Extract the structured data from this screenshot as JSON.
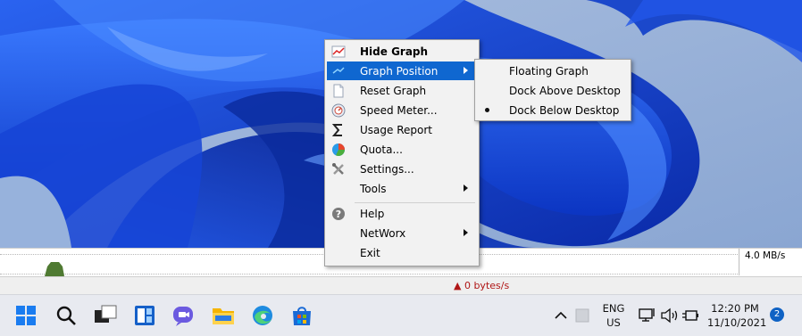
{
  "menu": {
    "items": [
      {
        "label": "Hide Graph",
        "icon": "graph-icon"
      },
      {
        "label": "Graph Position",
        "icon": "graph-position-icon",
        "selected": true
      },
      {
        "label": "Reset Graph",
        "icon": "reset-graph-icon"
      },
      {
        "label": "Speed Meter...",
        "icon": "speed-meter-icon"
      },
      {
        "label": "Usage Report",
        "icon": "sigma-icon"
      },
      {
        "label": "Quota...",
        "icon": "pie-chart-icon"
      },
      {
        "label": "Settings...",
        "icon": "tools-icon"
      },
      {
        "label": "Tools",
        "icon": ""
      },
      {
        "label": "Help",
        "icon": "help-icon"
      },
      {
        "label": "NetWorx",
        "icon": ""
      },
      {
        "label": "Exit",
        "icon": ""
      }
    ]
  },
  "submenu": {
    "items": [
      {
        "label": "Floating Graph",
        "checked": false
      },
      {
        "label": "Dock Above Desktop",
        "checked": false
      },
      {
        "label": "Dock Below Desktop",
        "checked": true
      }
    ]
  },
  "graph": {
    "scale_label": "4.0 MB/s",
    "speed_text": "▲ 0 bytes/s"
  },
  "taskbar": {
    "language_line1": "ENG",
    "language_line2": "US",
    "time": "12:20 PM",
    "date": "11/10/2021",
    "notification_count": "2",
    "icons": [
      "start-icon",
      "search-icon",
      "task-view-icon",
      "widgets-icon",
      "chat-icon",
      "file-explorer-icon",
      "edge-icon",
      "store-icon"
    ]
  },
  "colors": {
    "highlight": "#0f67d0",
    "speed_text": "#b01616",
    "wallpaper_dark": "#0a2fb0",
    "wallpaper_light": "#8ea8cf"
  }
}
